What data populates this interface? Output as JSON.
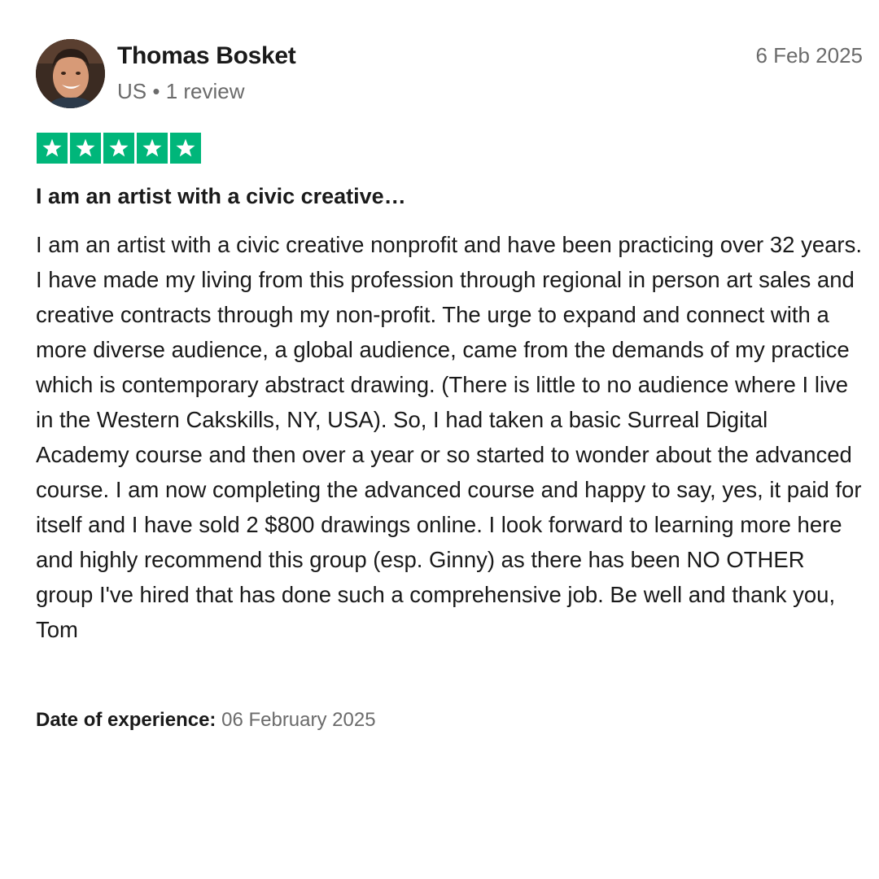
{
  "reviewer": {
    "name": "Thomas Bosket",
    "country": "US",
    "separator": "•",
    "review_count": "1 review"
  },
  "review": {
    "date": "6 Feb 2025",
    "rating": 5,
    "rating_color": "#00b67a",
    "title": "I am an artist with a civic creative…",
    "body": "I am an artist with a civic creative nonprofit and have been practicing over 32 years. I have made my living from this profession through regional in person art sales and creative contracts through my non-profit. The urge to expand and connect with a more diverse audience, a global audience, came from the demands of my practice which is contemporary abstract drawing. (There is little to no audience where I live in the Western Cakskills, NY, USA). So, I had taken a basic Surreal Digital Academy course and then over a year or so started to wonder about the advanced course. I am now completing the advanced course and happy to say, yes, it paid for itself and I have sold 2 $800 drawings online. I look forward to learning more here and highly recommend this group (esp. Ginny) as there has been NO OTHER group I've hired that has done such a comprehensive job. Be well and thank you, Tom",
    "experience_label": "Date of experience:",
    "experience_date": "06 February 2025"
  },
  "icons": {
    "avatar": "avatar-photo",
    "star": "star-icon"
  }
}
